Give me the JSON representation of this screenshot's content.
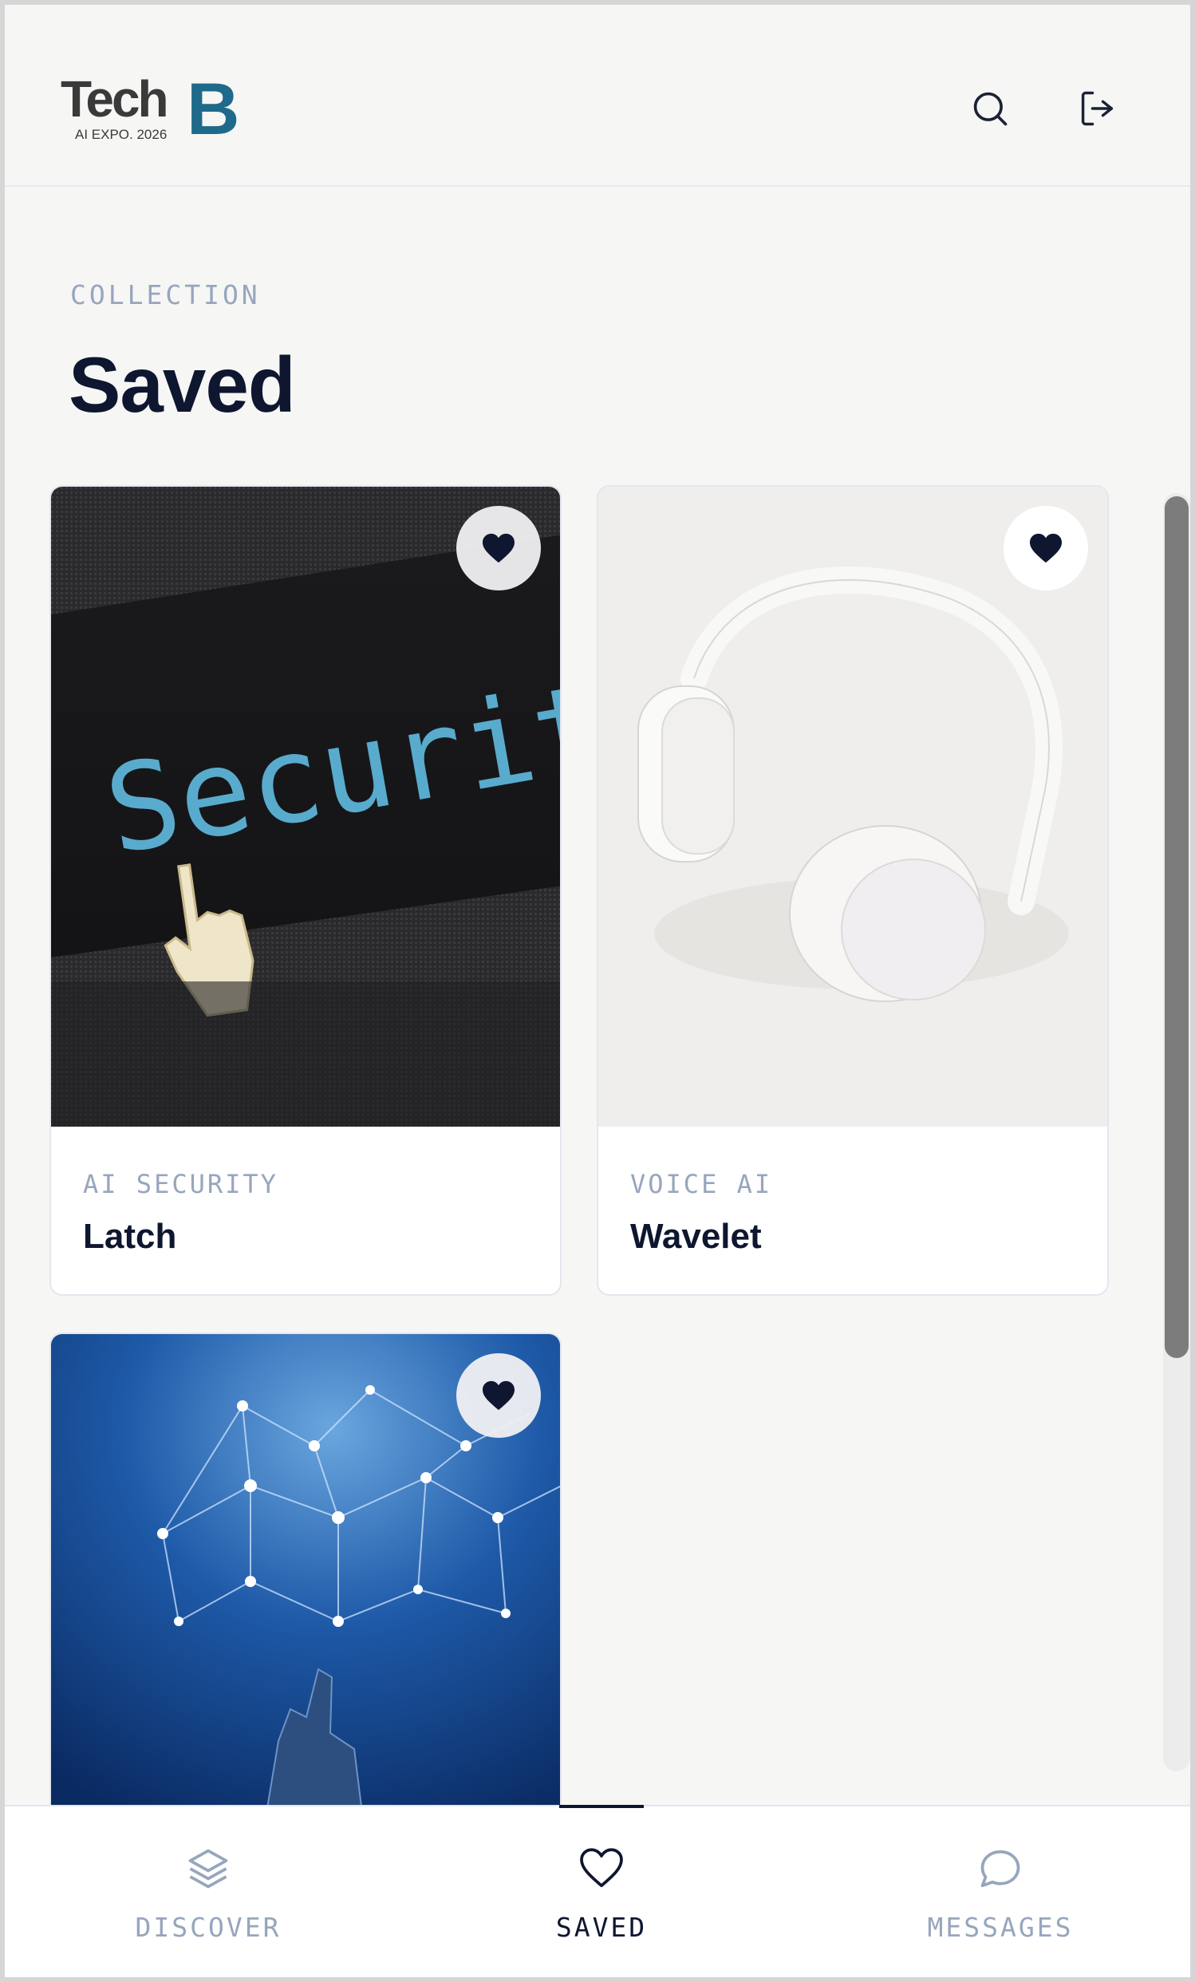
{
  "header": {
    "logo_text": "Tech",
    "logo_mark": "B",
    "logo_sub": "AI EXPO. 2026",
    "search_icon": "search-icon",
    "logout_icon": "logout-icon"
  },
  "page": {
    "eyebrow": "COLLECTION",
    "title": "Saved"
  },
  "cards": [
    {
      "category": "AI SECURITY",
      "name": "Latch",
      "image": "security-screen-image",
      "saved": true
    },
    {
      "category": "VOICE AI",
      "name": "Wavelet",
      "image": "white-headphones-image",
      "saved": true
    },
    {
      "category": "",
      "name": "",
      "image": "neural-network-hand-image",
      "saved": true
    }
  ],
  "bottom_nav": {
    "items": [
      {
        "label": "DISCOVER",
        "icon": "layers-icon",
        "active": false
      },
      {
        "label": "SAVED",
        "icon": "heart-icon",
        "active": true
      },
      {
        "label": "MESSAGES",
        "icon": "chat-bubble-icon",
        "active": false
      }
    ]
  },
  "colors": {
    "background": "#f6f6f5",
    "text_dark": "#0e1630",
    "text_muted": "#97a6bd",
    "logo_accent": "#1f6a8a"
  }
}
